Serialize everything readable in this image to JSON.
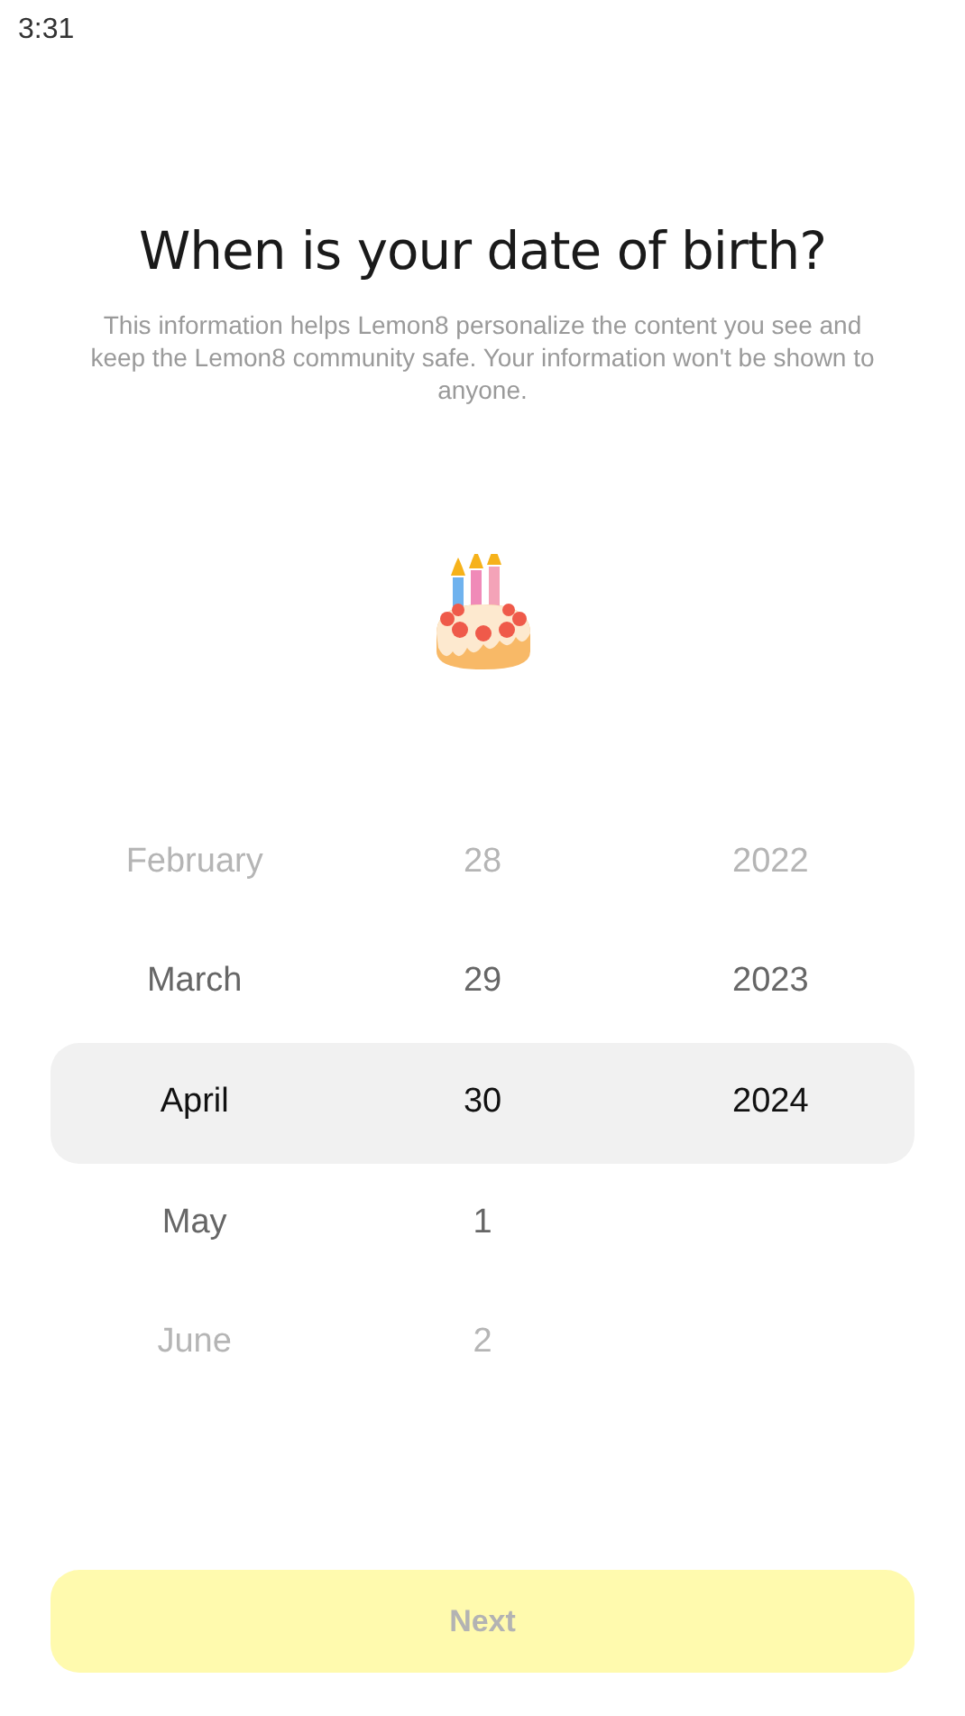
{
  "status_bar": {
    "time": "3:31"
  },
  "title": "When is your date of birth?",
  "description": "This information helps Lemon8 personalize the content you see and keep the Lemon8 community safe. Your information won't be shown to anyone.",
  "picker": {
    "columns": [
      {
        "items": [
          {
            "label": "February",
            "selected": false
          },
          {
            "label": "March",
            "selected": false
          },
          {
            "label": "April",
            "selected": true
          },
          {
            "label": "May",
            "selected": false
          },
          {
            "label": "June",
            "selected": false
          }
        ]
      },
      {
        "items": [
          {
            "label": "28",
            "selected": false
          },
          {
            "label": "29",
            "selected": false
          },
          {
            "label": "30",
            "selected": true
          },
          {
            "label": "1",
            "selected": false
          },
          {
            "label": "2",
            "selected": false
          }
        ]
      },
      {
        "items": [
          {
            "label": "2022",
            "selected": false
          },
          {
            "label": "2023",
            "selected": false
          },
          {
            "label": "2024",
            "selected": true
          }
        ]
      }
    ]
  },
  "next_button": {
    "label": "Next",
    "disabled": true
  }
}
